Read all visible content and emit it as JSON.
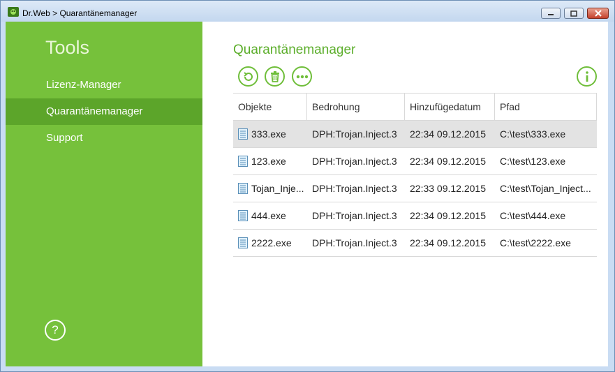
{
  "window": {
    "title": "Dr.Web > Quarantänemanager"
  },
  "sidebar": {
    "title": "Tools",
    "items": [
      {
        "label": "Lizenz-Manager",
        "active": false
      },
      {
        "label": "Quarantänemanager",
        "active": true
      },
      {
        "label": "Support",
        "active": false
      }
    ],
    "help_label": "?"
  },
  "main": {
    "title": "Quarantänemanager",
    "toolbar": [
      "restore-icon",
      "delete-icon",
      "more-icon",
      "info-icon"
    ],
    "table": {
      "columns": [
        "Objekte",
        "Bedrohung",
        "Hinzufügedatum",
        "Pfad"
      ],
      "rows": [
        {
          "object": "333.exe",
          "threat": "DPH:Trojan.Inject.3",
          "date": "22:34 09.12.2015",
          "path": "C:\\test\\333.exe",
          "selected": true
        },
        {
          "object": "123.exe",
          "threat": "DPH:Trojan.Inject.3",
          "date": "22:34 09.12.2015",
          "path": "C:\\test\\123.exe",
          "selected": false
        },
        {
          "object": "Tojan_Inje...",
          "threat": "DPH:Trojan.Inject.3",
          "date": "22:33 09.12.2015",
          "path": "C:\\test\\Tojan_Inject...",
          "selected": false
        },
        {
          "object": "444.exe",
          "threat": "DPH:Trojan.Inject.3",
          "date": "22:34 09.12.2015",
          "path": "C:\\test\\444.exe",
          "selected": false
        },
        {
          "object": "2222.exe",
          "threat": "DPH:Trojan.Inject.3",
          "date": "22:34 09.12.2015",
          "path": "C:\\test\\2222.exe",
          "selected": false
        }
      ]
    }
  },
  "colors": {
    "accent": "#76c13b",
    "accent_dark": "#5ca52a",
    "title_green": "#5cae2b"
  }
}
